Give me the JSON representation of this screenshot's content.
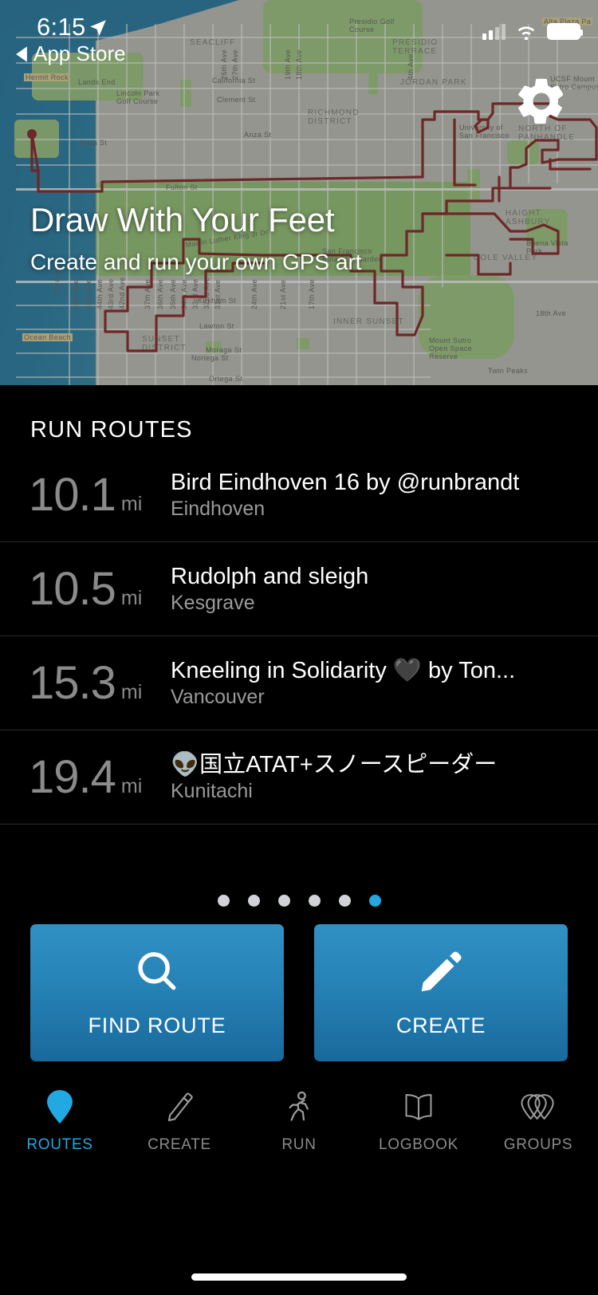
{
  "status_bar": {
    "time": "6:15",
    "back_label": "App Store",
    "location_icon": "location-arrow-icon",
    "signal_icon": "cellular-signal-icon",
    "wifi_icon": "wifi-icon",
    "battery_icon": "battery-icon"
  },
  "hero": {
    "title": "Draw With Your Feet",
    "subtitle": "Create and run your own GPS art",
    "settings_icon": "gear-icon",
    "map_labels": [
      "SEACLIFF",
      "Hermit Rock",
      "Lands End",
      "Lincoln Park Golf Course",
      "Presidio Golf Course",
      "PRESIDIO TERRACE",
      "JORDAN PARK",
      "Alta Plaza Park",
      "California St",
      "Clement St",
      "Anza St",
      "RICHMOND DISTRICT",
      "Fulton St",
      "Martin Luther King Jr Dr",
      "University of San Francisco",
      "NORTH OF PANHANDLE",
      "HAIGHT ASHBURY",
      "Buena Vista Park",
      "COLE VALLEY",
      "INNER SUNSET",
      "Mount Sutro Open Space Reserve",
      "Kirkham St",
      "Lawton St",
      "Moraga St",
      "Noriega St",
      "Ortega St",
      "SUNSET DISTRICT",
      "Ocean Beach",
      "Great Hwy",
      "Twin Peaks",
      "San Francisco Botanical Garden",
      "18th Ave",
      "21st Ave",
      "24th Ave",
      "17th Ave",
      "31st Ave",
      "32nd Ave",
      "33rd Ave",
      "34th Ave",
      "35th Ave",
      "36th Ave",
      "37th Ave",
      "42nd Ave",
      "43rd Ave",
      "44th Ave",
      "45th Ave",
      "46th Ave",
      "26th Ave",
      "27th Ave",
      "19th Ave",
      "18th Ave",
      "4th Ave",
      "UCSF Mount Sutro Campus"
    ],
    "route_color": "#8e2b2b"
  },
  "routes_section": {
    "heading": "RUN ROUTES",
    "items": [
      {
        "distance": "10.1",
        "unit": "mi",
        "name": "Bird Eindhoven 16 by @runbrandt",
        "city": "Eindhoven"
      },
      {
        "distance": "10.5",
        "unit": "mi",
        "name": "Rudolph and sleigh",
        "city": "Kesgrave"
      },
      {
        "distance": "15.3",
        "unit": "mi",
        "name": "Kneeling in Solidarity 🖤 by Ton...",
        "city": "Vancouver"
      },
      {
        "distance": "19.4",
        "unit": "mi",
        "name": "👽国立ATAT+スノースピーダー",
        "city": "Kunitachi"
      }
    ]
  },
  "pager": {
    "total": 6,
    "active_index": 5
  },
  "actions": [
    {
      "label": "FIND ROUTE",
      "icon": "search-icon"
    },
    {
      "label": "CREATE",
      "icon": "pencil-icon"
    }
  ],
  "tab_bar": {
    "active_index": 0,
    "items": [
      {
        "label": "ROUTES",
        "icon": "map-pin-icon"
      },
      {
        "label": "CREATE",
        "icon": "pencil-icon"
      },
      {
        "label": "RUN",
        "icon": "running-person-icon"
      },
      {
        "label": "LOGBOOK",
        "icon": "open-book-icon"
      },
      {
        "label": "GROUPS",
        "icon": "groups-teardrops-icon"
      }
    ]
  },
  "colors": {
    "accent": "#23a9e1",
    "button_top": "#3190c4",
    "button_bottom": "#19699c",
    "background": "#000000",
    "muted_text": "#8b8b8b"
  }
}
